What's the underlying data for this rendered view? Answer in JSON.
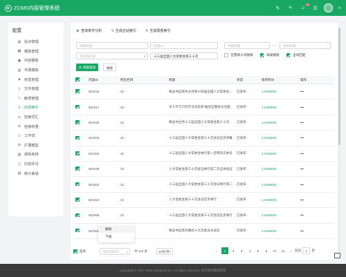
{
  "app": {
    "title": "ZCMS内容管理系统",
    "notification_count": "10"
  },
  "colors": {
    "brand": "#18a863",
    "footer_bg": "#3a3a3a"
  },
  "sidebar": {
    "title": "配置",
    "items": [
      {
        "label": "站点管理",
        "icon": "site-icon"
      },
      {
        "label": "模板管理",
        "icon": "template-icon"
      },
      {
        "label": "内容模板",
        "icon": "content-template-icon"
      },
      {
        "label": "专题模板",
        "icon": "topic-template-icon"
      },
      {
        "label": "标签管理",
        "icon": "tag-icon"
      },
      {
        "label": "文件管理",
        "icon": "file-icon"
      },
      {
        "label": "敏感管理",
        "icon": "sensitive-icon"
      },
      {
        "label": "内容索引",
        "icon": "index-icon",
        "active": true
      },
      {
        "label": "检索词汇",
        "icon": "search-word-icon"
      },
      {
        "label": "检索权重",
        "icon": "search-weight-icon"
      },
      {
        "label": "工作流",
        "icon": "workflow-icon"
      },
      {
        "label": "扩展模型",
        "icon": "extend-model-icon"
      },
      {
        "label": "绩效考核",
        "icon": "performance-icon"
      },
      {
        "label": "内容评论",
        "icon": "comment-icon"
      },
      {
        "label": "统计渠道",
        "icon": "stats-icon"
      }
    ]
  },
  "tabs": [
    {
      "label": "查询条件分析",
      "icon": "search-icon"
    },
    {
      "label": "生成全站索引",
      "icon": "bolt-icon"
    },
    {
      "label": "生成局部索引",
      "icon": "bolt-icon"
    }
  ],
  "filters": {
    "title_placeholder": "请输标题",
    "columns_placeholder": "请选择栏目",
    "id_placeholder": "内容ID",
    "keyword_value": "十三届全国人大常委会第三十次",
    "start_date_placeholder": "开始日期",
    "end_date_placeholder": "结束日期",
    "date_separator": "—",
    "opt_full_match": "应用同义词搜索",
    "opt_published": "高级搜索",
    "opt_all": "全词匹配",
    "search_button": "高级查询",
    "reset_button": "搜索"
  },
  "table": {
    "headers": {
      "id": "内容ID",
      "column": "所在栏目",
      "title": "标题",
      "status": "状态",
      "sort": "排序积分",
      "op": "操作"
    },
    "rows": [
      {
        "id": "501016",
        "column": "22",
        "title": "栗战书出席并主持第十四届全国人大常委会…",
        "status": "已发布",
        "sort": "1.0486693",
        "op": "•••"
      },
      {
        "id": "501017",
        "column": "22",
        "title": "深入学习习近平法治思想 推动全面依法治国…",
        "status": "已发布",
        "sort": "1.0486693",
        "op": "•••"
      },
      {
        "id": "501028",
        "column": "22",
        "title": "栗战书主持十三届全国人大常委会第三十次…",
        "status": "已发布",
        "sort": "1.0486693",
        "op": "•••"
      },
      {
        "id": "501033",
        "column": "22",
        "title": "十三届全国人大常委会第三十次会议在京闭幕",
        "status": "已发布",
        "sort": "1.0486693",
        "op": "•••"
      },
      {
        "id": "501032",
        "column": "22",
        "title": "十三届全国人大常委会举行第一百零四次委员…",
        "status": "已发布",
        "sort": "1.0486693",
        "op": "•••"
      },
      {
        "id": "501048",
        "column": "22",
        "title": "人大常委会第三十次会议举行第二次全体会议…",
        "status": "已发布",
        "sort": "1.0486693",
        "op": "•••"
      },
      {
        "id": "501052",
        "column": "22",
        "title": "十三届全国人大常委会第三十次会议举行第二…",
        "status": "已发布",
        "sort": "1.0486693",
        "op": "•••"
      },
      {
        "id": "501054",
        "column": "22",
        "title": "人大常委会第三十次会议在京举行",
        "status": "已发布",
        "sort": "1.0486693",
        "op": "•••"
      },
      {
        "id": "501058",
        "column": "22",
        "title": "十三届全国人大常委会第三十次会议在京举行…",
        "status": "已发布",
        "sort": "1.0486693",
        "op": "•••"
      },
      {
        "id": "501059",
        "column": "22",
        "title": "栗战书出席开幕式十九次委员长会议",
        "status": "已发布",
        "sort": "1.0486693",
        "op": "•••"
      }
    ]
  },
  "popup": {
    "items": [
      "删除",
      "下线"
    ]
  },
  "footer": {
    "select_all": "选择",
    "batch_placeholder": "请选择操作",
    "total": "共 116 条",
    "page_size": "10条/页",
    "pages": [
      "‹",
      "1",
      "2",
      "3",
      "4",
      "5",
      "6",
      "•••",
      "11",
      "›"
    ],
    "current_page": "1",
    "goto_label": "前往",
    "goto_value": "1",
    "goto_unit": "页"
  },
  "copyright": "Copyright © 2007-2022 ZvingSoft,Inc. All rights reserved. 泽元软件版权所有"
}
